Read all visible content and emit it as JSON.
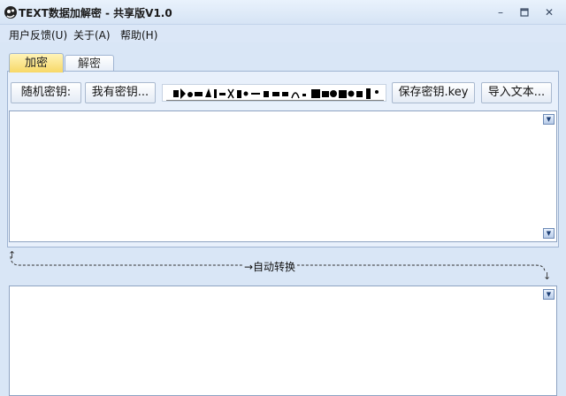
{
  "window": {
    "title": "TEXT数据加解密 - 共享版V1.0",
    "icon": "app-logo-icon",
    "controls": [
      "minimize-icon",
      "maximize-icon",
      "close-icon"
    ]
  },
  "menu": {
    "items": [
      {
        "label": "用户反馈(U)"
      },
      {
        "label": "关于(A)"
      },
      {
        "label": "帮助(H)"
      }
    ]
  },
  "tabs": [
    {
      "label": "加密",
      "active": true
    },
    {
      "label": "解密",
      "active": false
    }
  ],
  "toolbar": {
    "random_key_label": "随机密钥:",
    "have_key_label": "我有密钥...",
    "save_key_label": "保存密钥.key",
    "import_text_label": "导入文本..."
  },
  "auto_convert": {
    "label": "→自动转换"
  },
  "colors": {
    "window_bg": "#d9e6f6",
    "active_tab": "#f7d867",
    "border": "#9fb4d2"
  }
}
